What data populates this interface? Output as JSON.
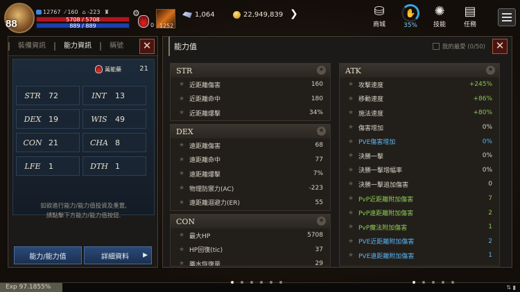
{
  "player": {
    "level": "88",
    "power": "12767",
    "stat_a": "160",
    "stat_b": "-223",
    "hp": "5708 / 5708",
    "mp": "889 / 889",
    "potion_count": "0",
    "skill_count": "1252"
  },
  "currency": {
    "gems": "1,064",
    "gold": "22,949,839"
  },
  "topnav": [
    {
      "label": "商城",
      "icon": "shop-icon"
    },
    {
      "label": "35%",
      "icon": "progress-ring-icon"
    },
    {
      "label": "技能",
      "icon": "skill-icon"
    },
    {
      "label": "任務",
      "icon": "quest-icon"
    }
  ],
  "left_panel": {
    "tabs": [
      "裝備資訊",
      "能力資訊",
      "稱號"
    ],
    "potion_label": "萬能藥",
    "potion_value": "21",
    "attributes": [
      {
        "name": "STR",
        "value": "72"
      },
      {
        "name": "INT",
        "value": "13"
      },
      {
        "name": "DEX",
        "value": "19"
      },
      {
        "name": "WIS",
        "value": "49"
      },
      {
        "name": "CON",
        "value": "21"
      },
      {
        "name": "CHA",
        "value": "8"
      },
      {
        "name": "LFE",
        "value": "1"
      },
      {
        "name": "DTH",
        "value": "1"
      }
    ],
    "hint_line1": "如欲進行能力/能力值投資及重置,",
    "hint_line2": "請點擊下方能力/能力值按鈕.",
    "btn_ability": "能力/能力值",
    "btn_detail": "詳細資料"
  },
  "right_panel": {
    "title": "能力值",
    "favorites": "我的最愛 (0/50)",
    "sections": [
      {
        "title": "STR",
        "rows": [
          {
            "label": "近距離傷害",
            "value": "160"
          },
          {
            "label": "近距離命中",
            "value": "180"
          },
          {
            "label": "近距離爆擊",
            "value": "34%"
          }
        ]
      },
      {
        "title": "DEX",
        "rows": [
          {
            "label": "遠距離傷害",
            "value": "68"
          },
          {
            "label": "遠距離命中",
            "value": "77"
          },
          {
            "label": "遠距離爆擊",
            "value": "7%"
          },
          {
            "label": "物理防禦力(AC)",
            "value": "-223"
          },
          {
            "label": "遠距離迴避力(ER)",
            "value": "55"
          }
        ]
      },
      {
        "title": "CON",
        "rows": [
          {
            "label": "最大HP",
            "value": "5708"
          },
          {
            "label": "HP回復(tic)",
            "value": "37"
          },
          {
            "label": "藥水恢復量",
            "value": "29"
          }
        ]
      },
      {
        "title": "ATK",
        "rows": [
          {
            "label": "攻擊速度",
            "value": "+245%",
            "color": "green"
          },
          {
            "label": "移動速度",
            "value": "+86%",
            "color": "green"
          },
          {
            "label": "施法速度",
            "value": "+80%",
            "color": "green"
          },
          {
            "label": "傷害增加",
            "value": "0%"
          },
          {
            "label": "PVE傷害增加",
            "value": "0%",
            "color": "blue"
          },
          {
            "label": "決勝一擊",
            "value": "0%"
          },
          {
            "label": "決勝一擊增幅率",
            "value": "0%"
          },
          {
            "label": "決勝一擊追加傷害",
            "value": "0"
          },
          {
            "label": "PvP近距離附加傷害",
            "value": "7",
            "color": "green"
          },
          {
            "label": "PvP遠距離附加傷害",
            "value": "2",
            "color": "green"
          },
          {
            "label": "PvP魔法附加傷害",
            "value": "1",
            "color": "green"
          },
          {
            "label": "PVE近距離附加傷害",
            "value": "2",
            "color": "blue"
          },
          {
            "label": "PVE遠距離附加傷害",
            "value": "1",
            "color": "blue"
          }
        ]
      }
    ]
  },
  "exp": "Exp 97.1855%",
  "colors": {
    "green": "#8cc850",
    "blue": "#5ab4f0",
    "hp": "#b01620",
    "mp": "#1c3fa8"
  }
}
